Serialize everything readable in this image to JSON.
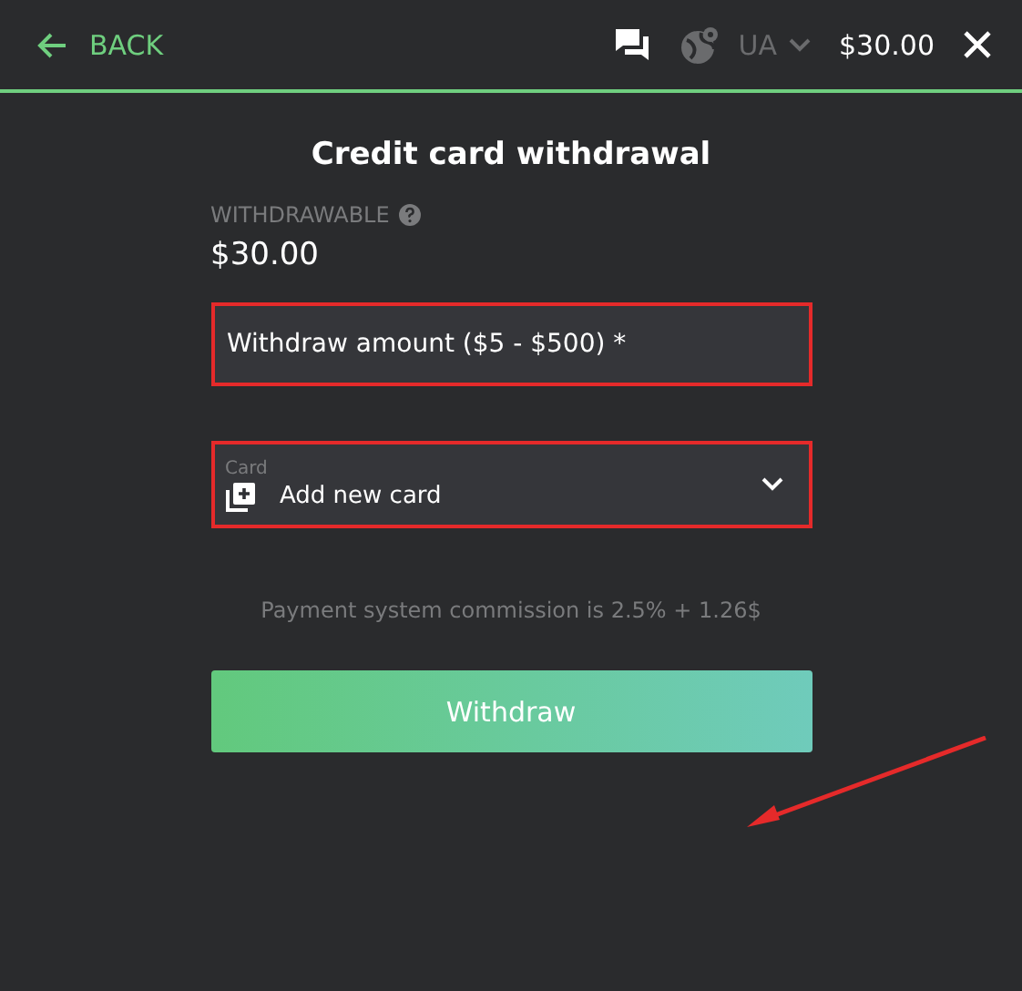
{
  "header": {
    "back": "BACK",
    "language": "UA",
    "balance": "$30.00"
  },
  "title": "Credit card withdrawal",
  "withdrawable": {
    "label": "WITHDRAWABLE",
    "amount": "$30.00"
  },
  "amount_field": {
    "placeholder": "Withdraw amount ($5 - $500) *",
    "highlighted": true
  },
  "card_select": {
    "label": "Card",
    "value": "Add new card",
    "highlighted": true
  },
  "commission": "Payment system commission is 2.5% + 1.26$",
  "submit": "Withdraw"
}
